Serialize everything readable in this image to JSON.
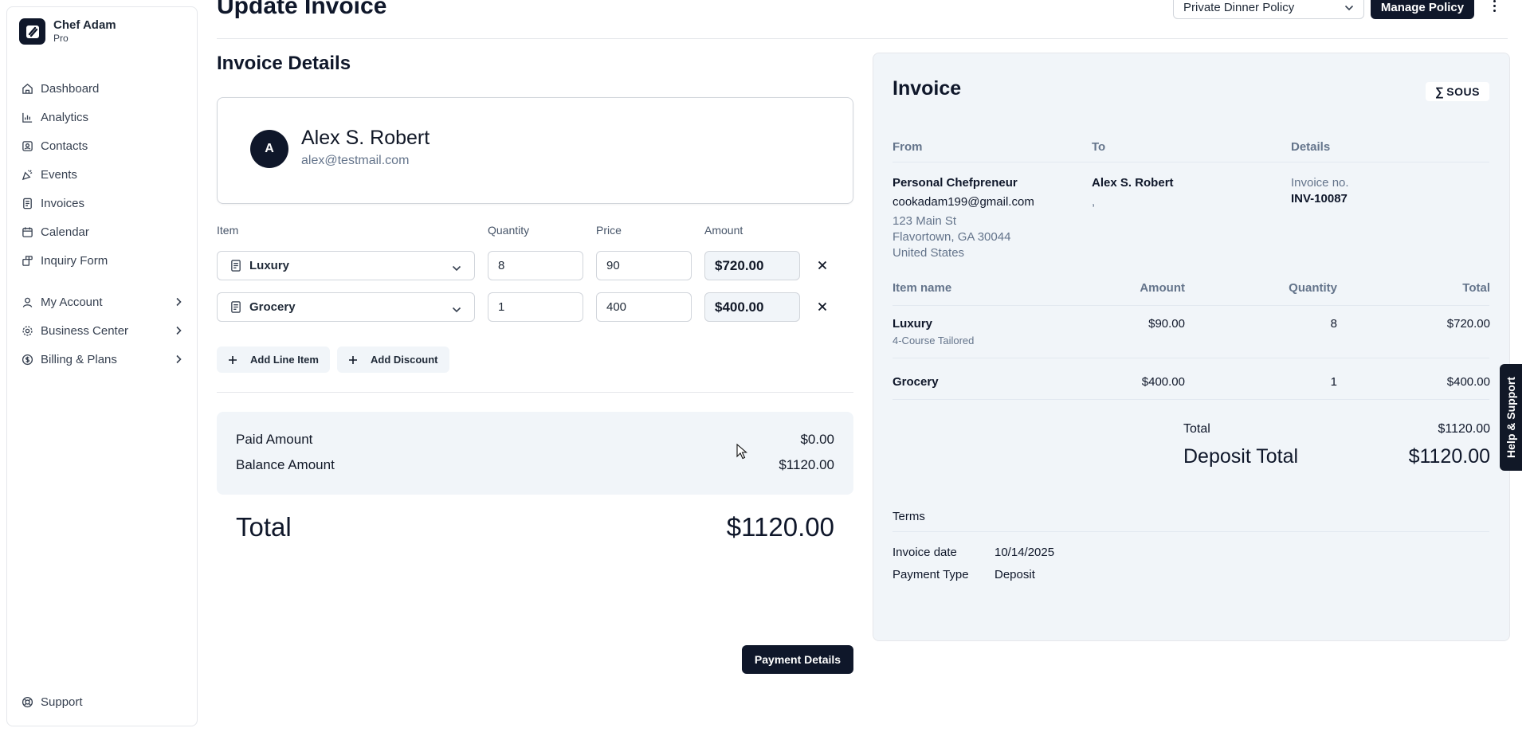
{
  "sidebar": {
    "brand_name": "Chef Adam",
    "brand_plan": "Pro",
    "items": [
      {
        "label": "Dashboard",
        "icon": "home-icon"
      },
      {
        "label": "Analytics",
        "icon": "bar-chart-icon"
      },
      {
        "label": "Contacts",
        "icon": "contact-icon"
      },
      {
        "label": "Events",
        "icon": "party-icon"
      },
      {
        "label": "Invoices",
        "icon": "document-icon"
      },
      {
        "label": "Calendar",
        "icon": "calendar-icon"
      },
      {
        "label": "Inquiry Form",
        "icon": "form-icon"
      }
    ],
    "groups": [
      {
        "label": "My Account",
        "icon": "user-icon"
      },
      {
        "label": "Business Center",
        "icon": "gear-icon"
      },
      {
        "label": "Billing & Plans",
        "icon": "dollar-icon"
      }
    ],
    "support_label": "Support"
  },
  "header": {
    "title": "Update Invoice",
    "policy_selected": "Private Dinner Policy",
    "manage_policy_label": "Manage Policy"
  },
  "form": {
    "section_title": "Invoice Details",
    "client": {
      "initial": "A",
      "name": "Alex S. Robert",
      "email": "alex@testmail.com"
    },
    "columns": {
      "item": "Item",
      "quantity": "Quantity",
      "price": "Price",
      "amount": "Amount"
    },
    "line_items": [
      {
        "item": "Luxury",
        "quantity": "8",
        "price": "90",
        "amount": "$720.00"
      },
      {
        "item": "Grocery",
        "quantity": "1",
        "price": "400",
        "amount": "$400.00"
      }
    ],
    "add_line_item_label": "Add Line Item",
    "add_discount_label": "Add Discount",
    "paid_amount_label": "Paid Amount",
    "paid_amount_value": "$0.00",
    "balance_amount_label": "Balance Amount",
    "balance_amount_value": "$1120.00",
    "total_label": "Total",
    "total_value": "$1120.00",
    "payment_details_label": "Payment Details"
  },
  "preview": {
    "title": "Invoice",
    "logo_text": "SOUS",
    "from_head": "From",
    "to_head": "To",
    "details_head": "Details",
    "from_name": "Personal Chefpreneur",
    "from_email": "cookadam199@gmail.com",
    "from_address1": "123 Main St",
    "from_address2": "Flavortown, GA 30044",
    "from_address3": "United States",
    "to_name": "Alex S. Robert",
    "to_extra": ",",
    "invoice_no_label": "Invoice no.",
    "invoice_no": "INV-10087",
    "table_heads": {
      "item_name": "Item name",
      "amount": "Amount",
      "quantity": "Quantity",
      "total": "Total"
    },
    "rows": [
      {
        "name": "Luxury",
        "sub": "4-Course Tailored",
        "amount": "$90.00",
        "quantity": "8",
        "total": "$720.00"
      },
      {
        "name": "Grocery",
        "sub": "",
        "amount": "$400.00",
        "quantity": "1",
        "total": "$400.00"
      }
    ],
    "total_label": "Total",
    "total_value": "$1120.00",
    "deposit_total_label": "Deposit Total",
    "deposit_total_value": "$1120.00",
    "terms_label": "Terms",
    "invoice_date_label": "Invoice date",
    "invoice_date": "10/14/2025",
    "payment_type_label": "Payment Type",
    "payment_type": "Deposit"
  },
  "help_tab_label": "Help & Support"
}
